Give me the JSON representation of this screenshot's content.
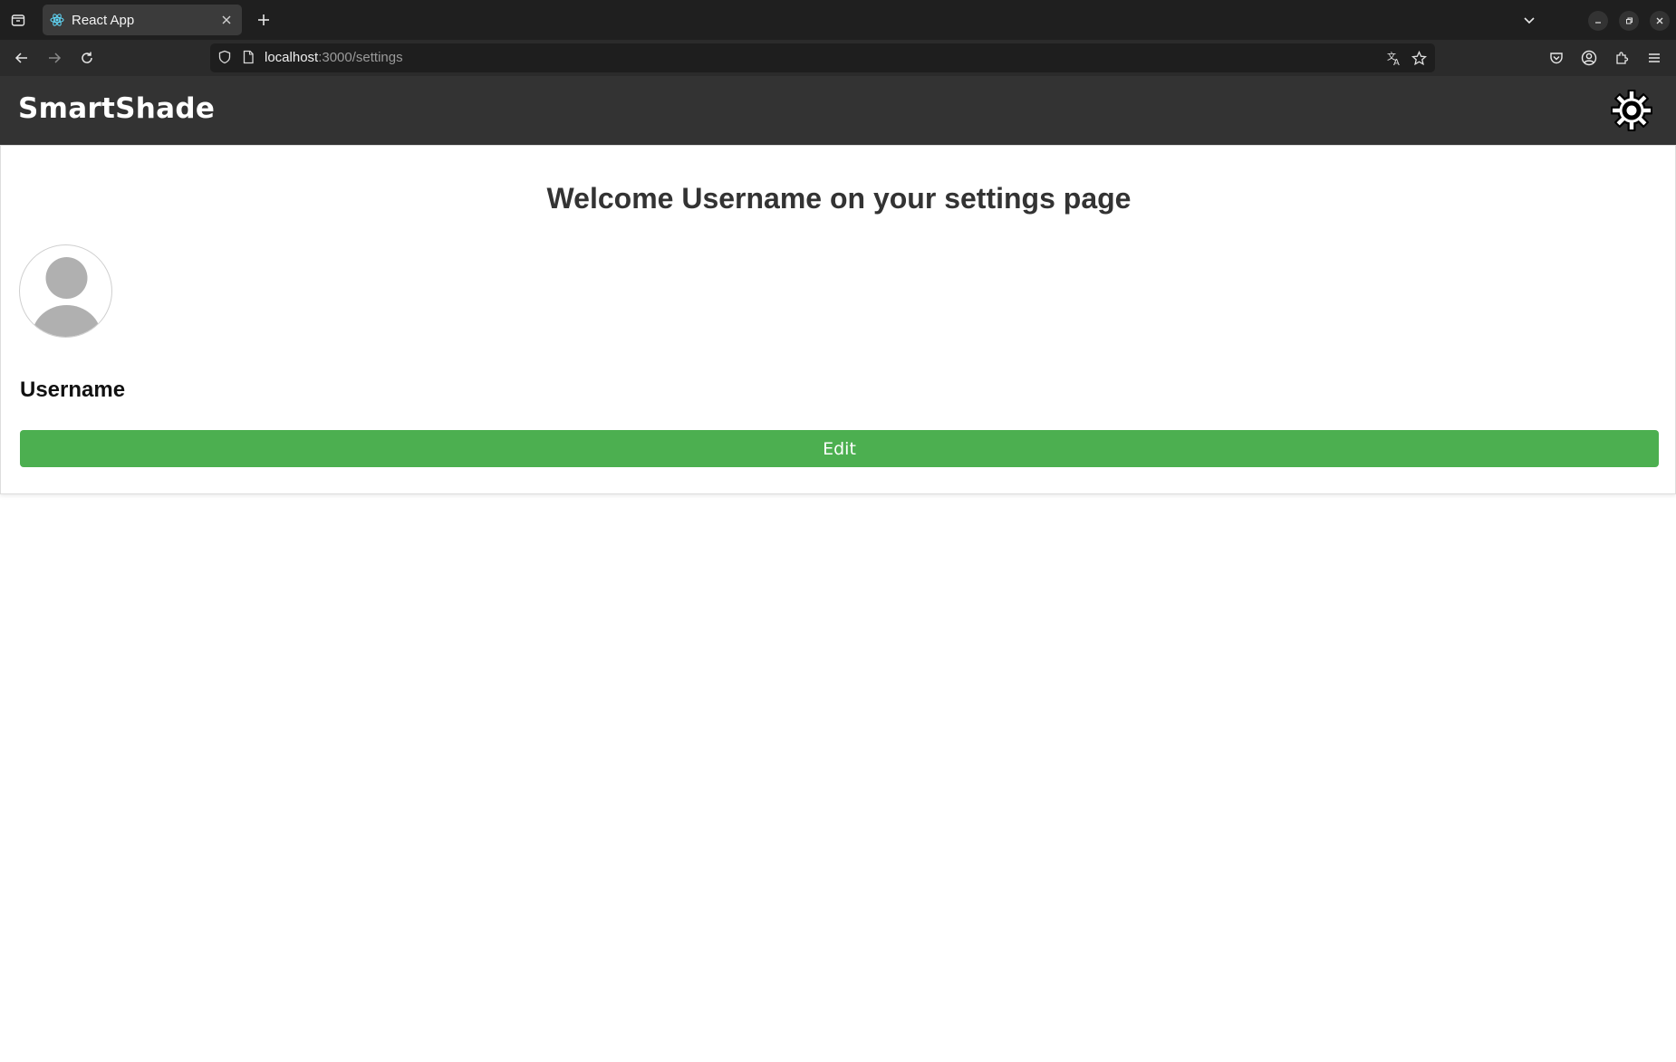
{
  "browser": {
    "tab_title": "React App",
    "url_host": "localhost",
    "url_path": ":3000/settings"
  },
  "header": {
    "brand": "SmartShade",
    "settings_icon": "gear-icon"
  },
  "settings": {
    "welcome_text": "Welcome Username on your settings page",
    "username": "Username",
    "edit_label": "Edit",
    "edit_color": "#4caf50"
  }
}
